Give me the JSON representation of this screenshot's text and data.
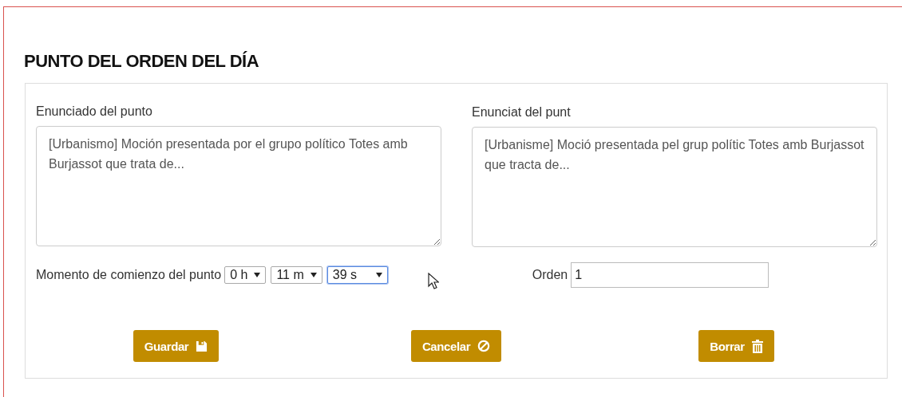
{
  "title": "PUNTO DEL ORDEN DEL DÍA",
  "statements": [
    {
      "label": "Enunciado del punto",
      "value": "[Urbanismo] Moción presentada por el grupo político Totes amb Burjassot que trata de..."
    },
    {
      "label": "Enunciat del punt",
      "value": "[Urbanisme] Moció presentada pel grup polític Totes amb Burjassot que tracta de..."
    }
  ],
  "start_time": {
    "label": "Momento de comienzo del punto",
    "selects": [
      {
        "value": "0 h",
        "focused": false
      },
      {
        "value": "11 m",
        "focused": false
      },
      {
        "value": "39 s",
        "focused": true
      }
    ]
  },
  "order": {
    "label": "Orden",
    "value": "1"
  },
  "buttons": [
    {
      "label": "Guardar",
      "kind": "save"
    },
    {
      "label": "Cancelar",
      "kind": "cancel"
    },
    {
      "label": "Borrar",
      "kind": "delete"
    }
  ]
}
